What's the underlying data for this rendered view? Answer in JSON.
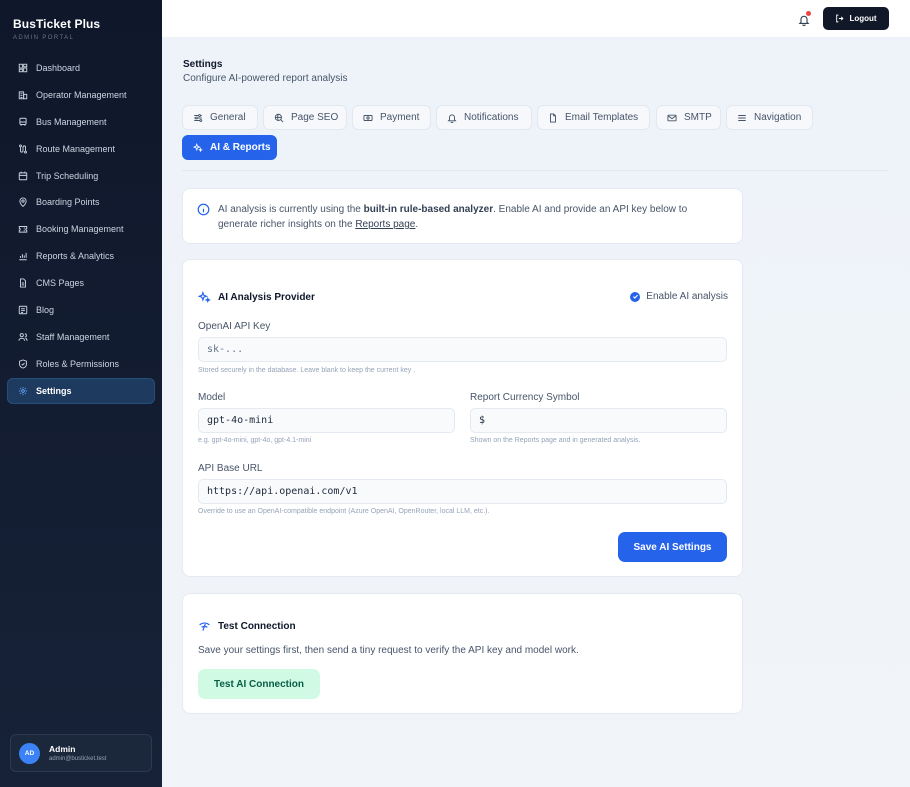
{
  "brand": {
    "name": "BusTicket Plus",
    "subtitle": "ADMIN PORTAL"
  },
  "sidebar": {
    "items": [
      {
        "label": "Dashboard",
        "icon": "dashboard-icon"
      },
      {
        "label": "Operator Management",
        "icon": "building-icon"
      },
      {
        "label": "Bus Management",
        "icon": "bus-icon"
      },
      {
        "label": "Route Management",
        "icon": "route-icon"
      },
      {
        "label": "Trip Scheduling",
        "icon": "calendar-icon"
      },
      {
        "label": "Boarding Points",
        "icon": "map-pin-icon"
      },
      {
        "label": "Booking Management",
        "icon": "ticket-icon"
      },
      {
        "label": "Reports & Analytics",
        "icon": "chart-icon"
      },
      {
        "label": "CMS Pages",
        "icon": "file-icon"
      },
      {
        "label": "Blog",
        "icon": "blog-icon"
      },
      {
        "label": "Staff Management",
        "icon": "users-icon"
      },
      {
        "label": "Roles & Permissions",
        "icon": "shield-icon"
      },
      {
        "label": "Settings",
        "icon": "gear-icon",
        "active": true
      }
    ]
  },
  "user": {
    "initials": "AD",
    "name": "Admin",
    "email": "admin@busticket.test"
  },
  "topbar": {
    "logout_label": "Logout"
  },
  "page": {
    "title": "Settings",
    "subtitle": "Configure AI-powered report analysis"
  },
  "tabs": [
    {
      "label": "General",
      "icon": "sliders-icon"
    },
    {
      "label": "Page SEO",
      "icon": "search-globe-icon"
    },
    {
      "label": "Payment",
      "icon": "cash-icon"
    },
    {
      "label": "Notifications",
      "icon": "bell-icon"
    },
    {
      "label": "Email Templates",
      "icon": "document-icon"
    },
    {
      "label": "SMTP",
      "icon": "mail-icon"
    },
    {
      "label": "Navigation",
      "icon": "menu-icon"
    },
    {
      "label": "AI & Reports",
      "icon": "sparkles-icon",
      "active": true
    }
  ],
  "info": {
    "text_before": "AI analysis is currently using the ",
    "text_bold": "built-in rule-based analyzer",
    "text_after": ". Enable AI and provide an API key below to generate richer insights on the ",
    "link": "Reports page",
    "text_end": "."
  },
  "provider": {
    "title": "AI Analysis Provider",
    "enable_label": "Enable AI analysis",
    "api_key": {
      "label": "OpenAI API Key",
      "placeholder": "sk-...",
      "hint": "Stored securely in the database. Leave blank to keep the current key ."
    },
    "model": {
      "label": "Model",
      "value": "gpt-4o-mini",
      "hint": "e.g. gpt-4o-mini, gpt-4o, gpt-4.1-mini"
    },
    "currency": {
      "label": "Report Currency Symbol",
      "value": "$",
      "hint": "Shown on the Reports page and in generated analysis."
    },
    "base_url": {
      "label": "API Base URL",
      "value": "https://api.openai.com/v1",
      "hint": "Override to use an OpenAI-compatible endpoint (Azure OpenAI, OpenRouter, local LLM, etc.)."
    },
    "save_label": "Save AI Settings"
  },
  "test": {
    "title": "Test Connection",
    "description": "Save your settings first, then send a tiny request to verify the API key and model work.",
    "button_label": "Test AI Connection"
  },
  "colors": {
    "accent": "#2563eb",
    "sidebar_bg": "#0f172a",
    "success_bg": "#d1fae5",
    "notification_dot": "#ef4444"
  }
}
